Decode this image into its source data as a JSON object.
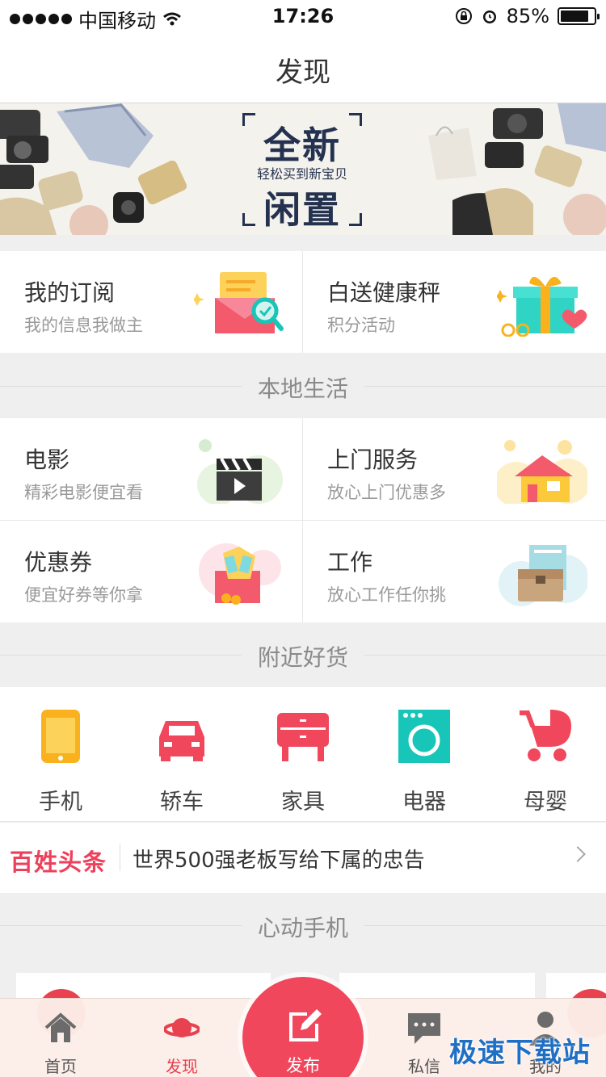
{
  "status_bar": {
    "carrier": "中国移动",
    "time": "17:26",
    "battery": "85%",
    "battery_level": 0.85
  },
  "nav": {
    "title": "发现"
  },
  "banner": {
    "line1": "全新",
    "tagline": "轻松买到新宝贝",
    "line2": "闲置"
  },
  "promo": [
    {
      "title": "我的订阅",
      "subtitle": "我的信息我做主",
      "icon": "subscription-envelope-icon"
    },
    {
      "title": "白送健康秤",
      "subtitle": "积分活动",
      "icon": "gift-box-icon"
    }
  ],
  "local": {
    "title": "本地生活",
    "items": [
      {
        "title": "电影",
        "subtitle": "精彩电影便宜看",
        "icon": "clapperboard-icon"
      },
      {
        "title": "上门服务",
        "subtitle": "放心上门优惠多",
        "icon": "house-icon"
      },
      {
        "title": "优惠券",
        "subtitle": "便宜好券等你拿",
        "icon": "coupon-envelope-icon"
      },
      {
        "title": "工作",
        "subtitle": "放心工作任你挑",
        "icon": "briefcase-icon"
      }
    ]
  },
  "nearby": {
    "title": "附近好货",
    "categories": [
      {
        "label": "手机",
        "icon": "phone-icon",
        "color": "#f9b21d"
      },
      {
        "label": "轿车",
        "icon": "car-icon",
        "color": "#f0475d"
      },
      {
        "label": "家具",
        "icon": "cabinet-icon",
        "color": "#f0475d"
      },
      {
        "label": "电器",
        "icon": "washing-machine-icon",
        "color": "#17c6b8"
      },
      {
        "label": "母婴",
        "icon": "stroller-icon",
        "color": "#f0475d"
      }
    ]
  },
  "news": {
    "brand": "百姓头条",
    "headline": "世界500强老板写给下属的忠告"
  },
  "phones": {
    "title": "心动手机"
  },
  "tabbar": {
    "tabs": [
      {
        "label": "首页",
        "icon": "home-icon"
      },
      {
        "label": "发现",
        "icon": "planet-icon"
      },
      {
        "label": "发布",
        "icon": "edit-icon"
      },
      {
        "label": "私信",
        "icon": "message-icon"
      },
      {
        "label": "我的",
        "icon": "user-icon"
      }
    ]
  },
  "watermark": "极速下载站",
  "colors": {
    "accent": "#f0475d",
    "teal": "#17c6b8",
    "yellow": "#f9b21d",
    "navy": "#25324f"
  }
}
